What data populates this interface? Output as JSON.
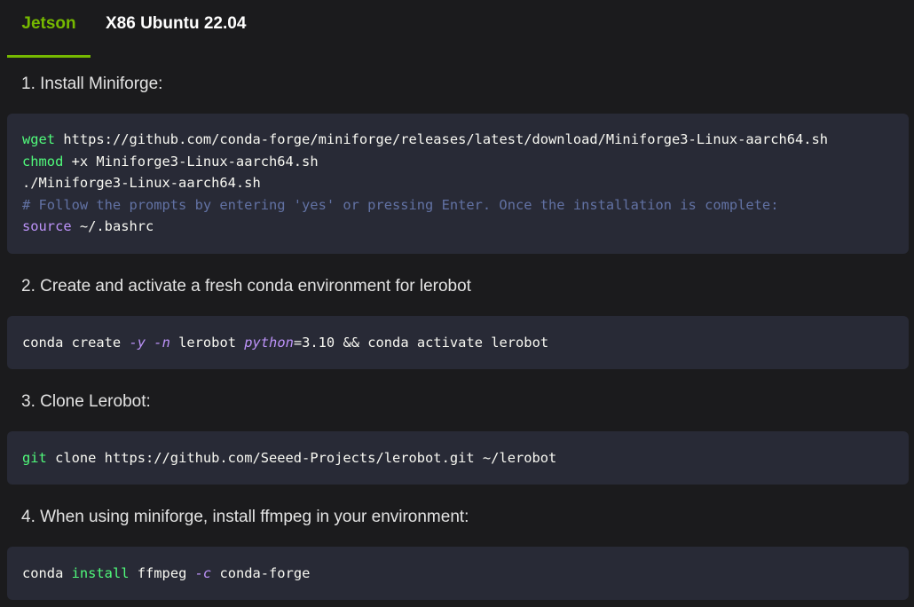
{
  "tabs": [
    {
      "label": "Jetson",
      "active": true
    },
    {
      "label": "X86 Ubuntu 22.04",
      "active": false
    }
  ],
  "colors": {
    "accent": "#76b900",
    "background": "#1b1b1d",
    "code_background": "#282a36",
    "code_command": "#50fa7b",
    "code_keyword": "#bd93f9",
    "code_comment": "#6272a4"
  },
  "steps": [
    {
      "heading": "1. Install Miniforge:",
      "code": [
        [
          {
            "t": "wget",
            "k": "cmd"
          },
          {
            "t": " https://github.com/conda-forge/miniforge/releases/latest/download/Miniforge3-Linux-aarch64.sh",
            "k": "plain"
          }
        ],
        [
          {
            "t": "chmod",
            "k": "cmd"
          },
          {
            "t": " +x Miniforge3-Linux-aarch64.sh",
            "k": "plain"
          }
        ],
        [
          {
            "t": "./Miniforge3-Linux-aarch64.sh",
            "k": "plain"
          }
        ],
        [
          {
            "t": "# Follow the prompts by entering 'yes' or pressing Enter. Once the installation is complete:",
            "k": "comment"
          }
        ],
        [
          {
            "t": "source",
            "k": "kw"
          },
          {
            "t": " ~/.bashrc",
            "k": "plain"
          }
        ]
      ]
    },
    {
      "heading": "2. Create and activate a fresh conda environment for lerobot",
      "code": [
        [
          {
            "t": "conda create ",
            "k": "plain"
          },
          {
            "t": "-y",
            "k": "flag"
          },
          {
            "t": " ",
            "k": "plain"
          },
          {
            "t": "-n",
            "k": "flag"
          },
          {
            "t": " lerobot ",
            "k": "plain"
          },
          {
            "t": "python",
            "k": "var"
          },
          {
            "t": "=3.10 && conda activate lerobot",
            "k": "plain"
          }
        ]
      ]
    },
    {
      "heading": "3. Clone Lerobot:",
      "code": [
        [
          {
            "t": "git",
            "k": "cmd"
          },
          {
            "t": " clone https://github.com/Seeed-Projects/lerobot.git ~/lerobot",
            "k": "plain"
          }
        ]
      ]
    },
    {
      "heading": "4. When using miniforge, install ffmpeg in your environment:",
      "code": [
        [
          {
            "t": "conda ",
            "k": "plain"
          },
          {
            "t": "install",
            "k": "cmd"
          },
          {
            "t": " ffmpeg ",
            "k": "plain"
          },
          {
            "t": "-c",
            "k": "flag"
          },
          {
            "t": " conda-forge",
            "k": "plain"
          }
        ]
      ]
    }
  ]
}
